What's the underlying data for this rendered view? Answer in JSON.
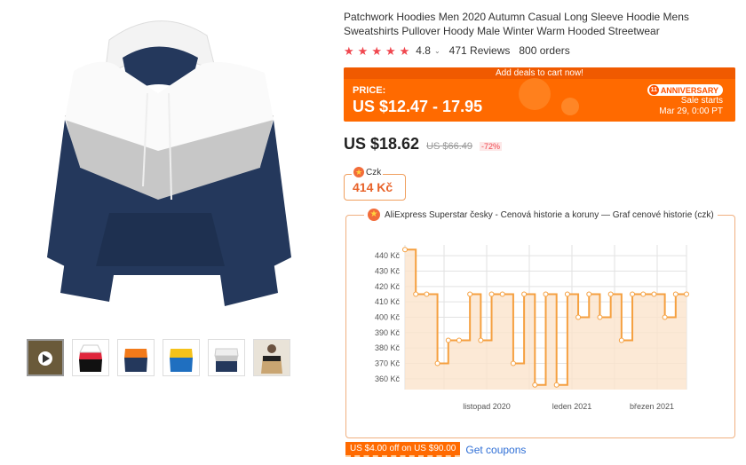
{
  "product": {
    "title": "Patchwork Hoodies Men 2020 Autumn Casual Long Sleeve Hoodie Mens Sweatshirts Pullover Hoody Male Winter Warm Hooded Streetwear",
    "rating": "4.8",
    "reviews": "471 Reviews",
    "orders": "800 orders"
  },
  "deal": {
    "strip_text": "Add deals to cart now!",
    "price_label": "PRICE:",
    "price_range": "US $12.47 - 17.95",
    "badge": "ANNIVERSARY",
    "sale_starts": "Sale starts",
    "sale_date": "Mar 29, 0:00 PT"
  },
  "pricing": {
    "current": "US $18.62",
    "original": "US $66.49",
    "discount": "-72%"
  },
  "czk": {
    "label": "Czk",
    "value": "414 Kč"
  },
  "history": {
    "title": "AliExpress Superstar česky - Cenová historie a koruny — Graf cenové historie (czk)"
  },
  "chart_data": {
    "type": "line",
    "title": "Graf cenové historie (czk)",
    "y_ticks": [
      "440 Kč",
      "430 Kč",
      "420 Kč",
      "410 Kč",
      "400 Kč",
      "390 Kč",
      "380 Kč",
      "370 Kč",
      "360 Kč"
    ],
    "x_labels": [
      "listopad 2020",
      "leden 2021",
      "březen 2021"
    ],
    "ylim": [
      353,
      447
    ],
    "series": [
      {
        "values": [
          444,
          415,
          415,
          370,
          385,
          385,
          415,
          385,
          415,
          415,
          370,
          415,
          356,
          415,
          356,
          415,
          400,
          415,
          400,
          415,
          385,
          415,
          415,
          415,
          400,
          415,
          415
        ]
      }
    ],
    "colors": {
      "line": "#f5a040",
      "area": "#fbe3cc",
      "grid": "#e2e2e2"
    }
  },
  "coupon": {
    "tag": "US $4.00 off on US $90.00",
    "link": "Get coupons"
  },
  "thumbnails": [
    "video-thumbnail",
    "black-red-white-hoodie",
    "orange-navy-hoodie",
    "yellow-blue-hoodie",
    "navy-white-hoodie",
    "model-hoodie"
  ]
}
